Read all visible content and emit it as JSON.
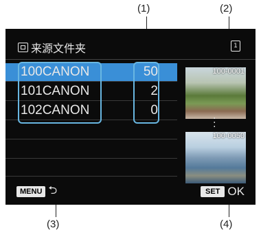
{
  "callouts": {
    "c1": "(1)",
    "c2": "(2)",
    "c3": "(3)",
    "c4": "(4)"
  },
  "screen": {
    "title": "来源文件夹",
    "card_slot": "1",
    "folders": [
      {
        "name": "100CANON",
        "count": "50",
        "selected": true
      },
      {
        "name": "101CANON",
        "count": "2"
      },
      {
        "name": "102CANON",
        "count": "0"
      }
    ],
    "thumbnails": [
      {
        "label": "100-0001"
      },
      {
        "label": "100-0050"
      }
    ],
    "menu_key": "MENU",
    "set_key": "SET",
    "ok_label": "OK"
  },
  "colors": {
    "selection": "#3a8fd7",
    "outline": "#69b7e2",
    "screen_bg": "#0b0b0b"
  }
}
